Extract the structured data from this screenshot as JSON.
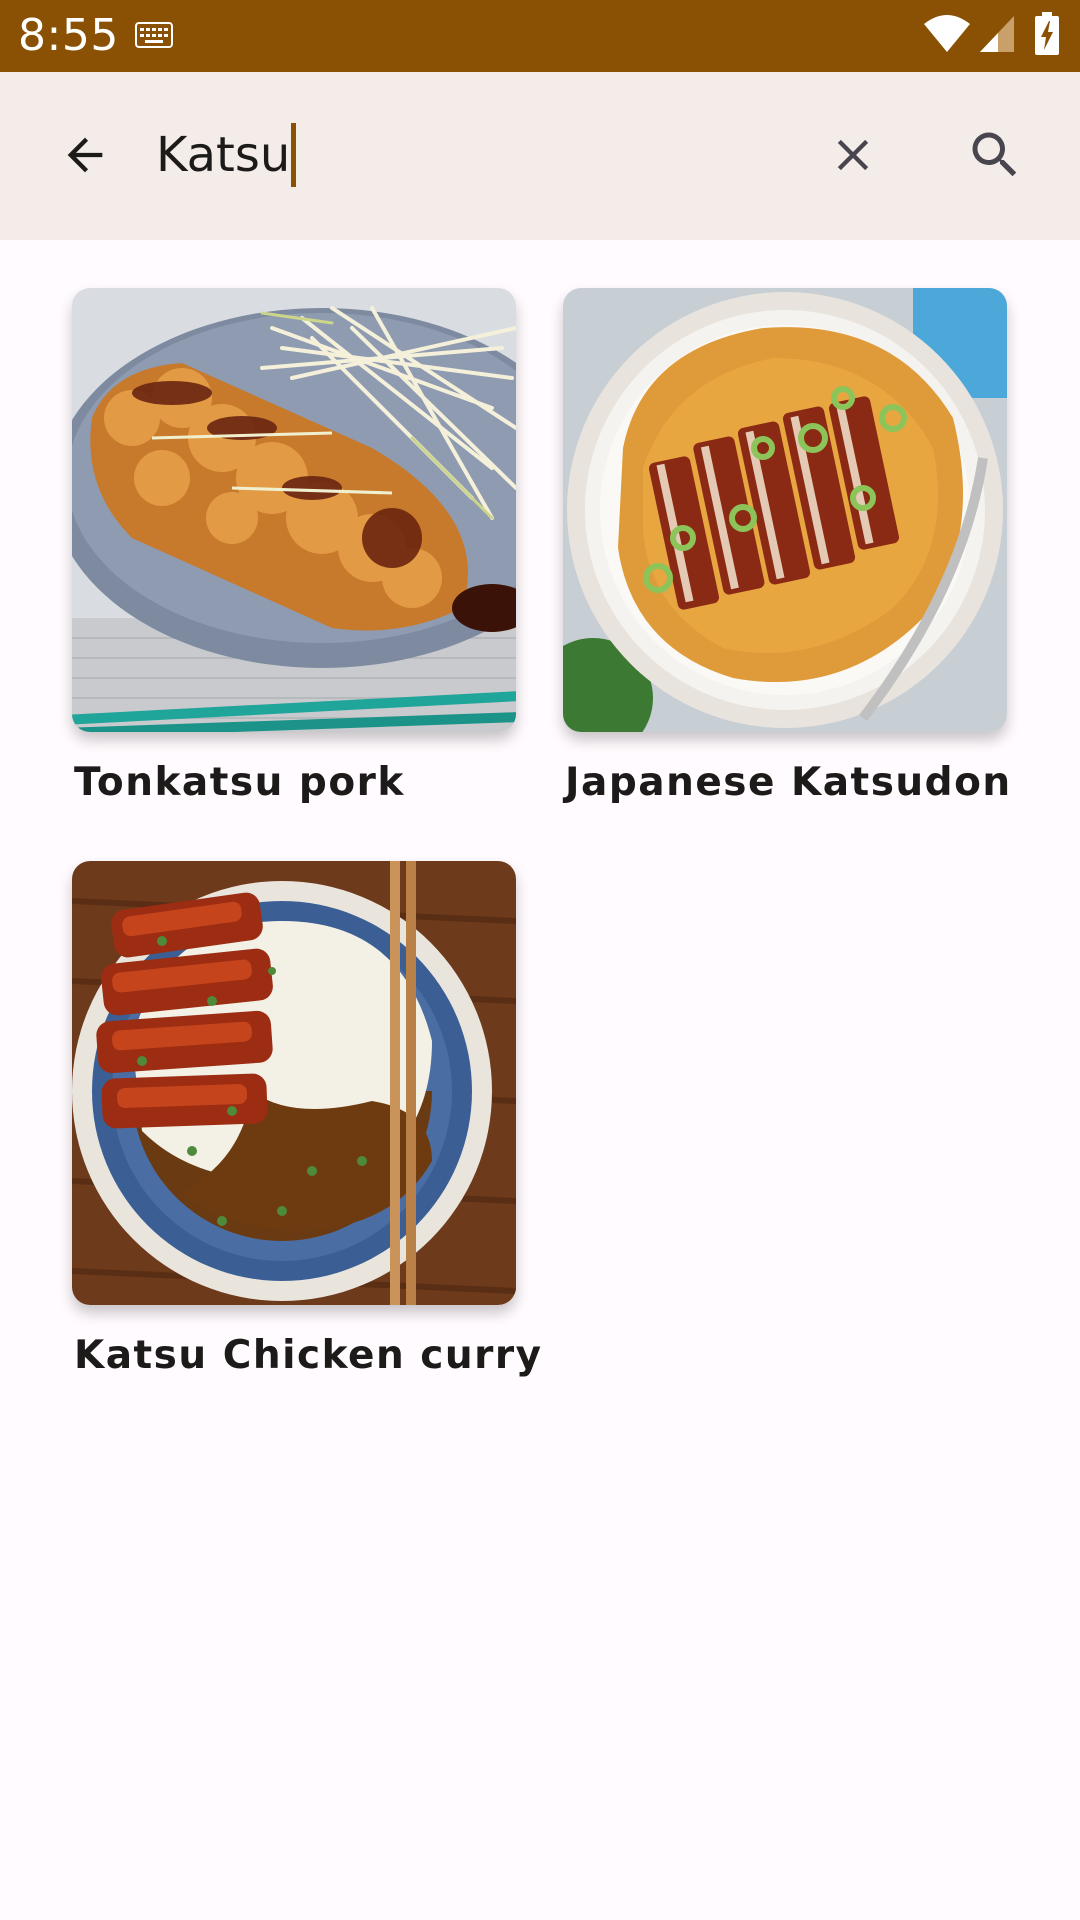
{
  "status_bar": {
    "time": "8:55",
    "icons": [
      "keyboard-icon",
      "wifi-icon",
      "signal-icon",
      "battery-charging-icon"
    ],
    "background": "#8a5104"
  },
  "search_bar": {
    "query": "Katsu",
    "back_icon": "arrow-back-icon",
    "clear_icon": "close-icon",
    "search_icon": "search-icon",
    "background": "#f3ece8",
    "accent": "#8a5104"
  },
  "results": [
    {
      "title": "Tonkatsu pork",
      "image": "tonkatsu-photo"
    },
    {
      "title": "Japanese Katsudon",
      "image": "katsudon-photo"
    },
    {
      "title": "Katsu Chicken curry",
      "image": "katsu-curry-photo"
    }
  ]
}
